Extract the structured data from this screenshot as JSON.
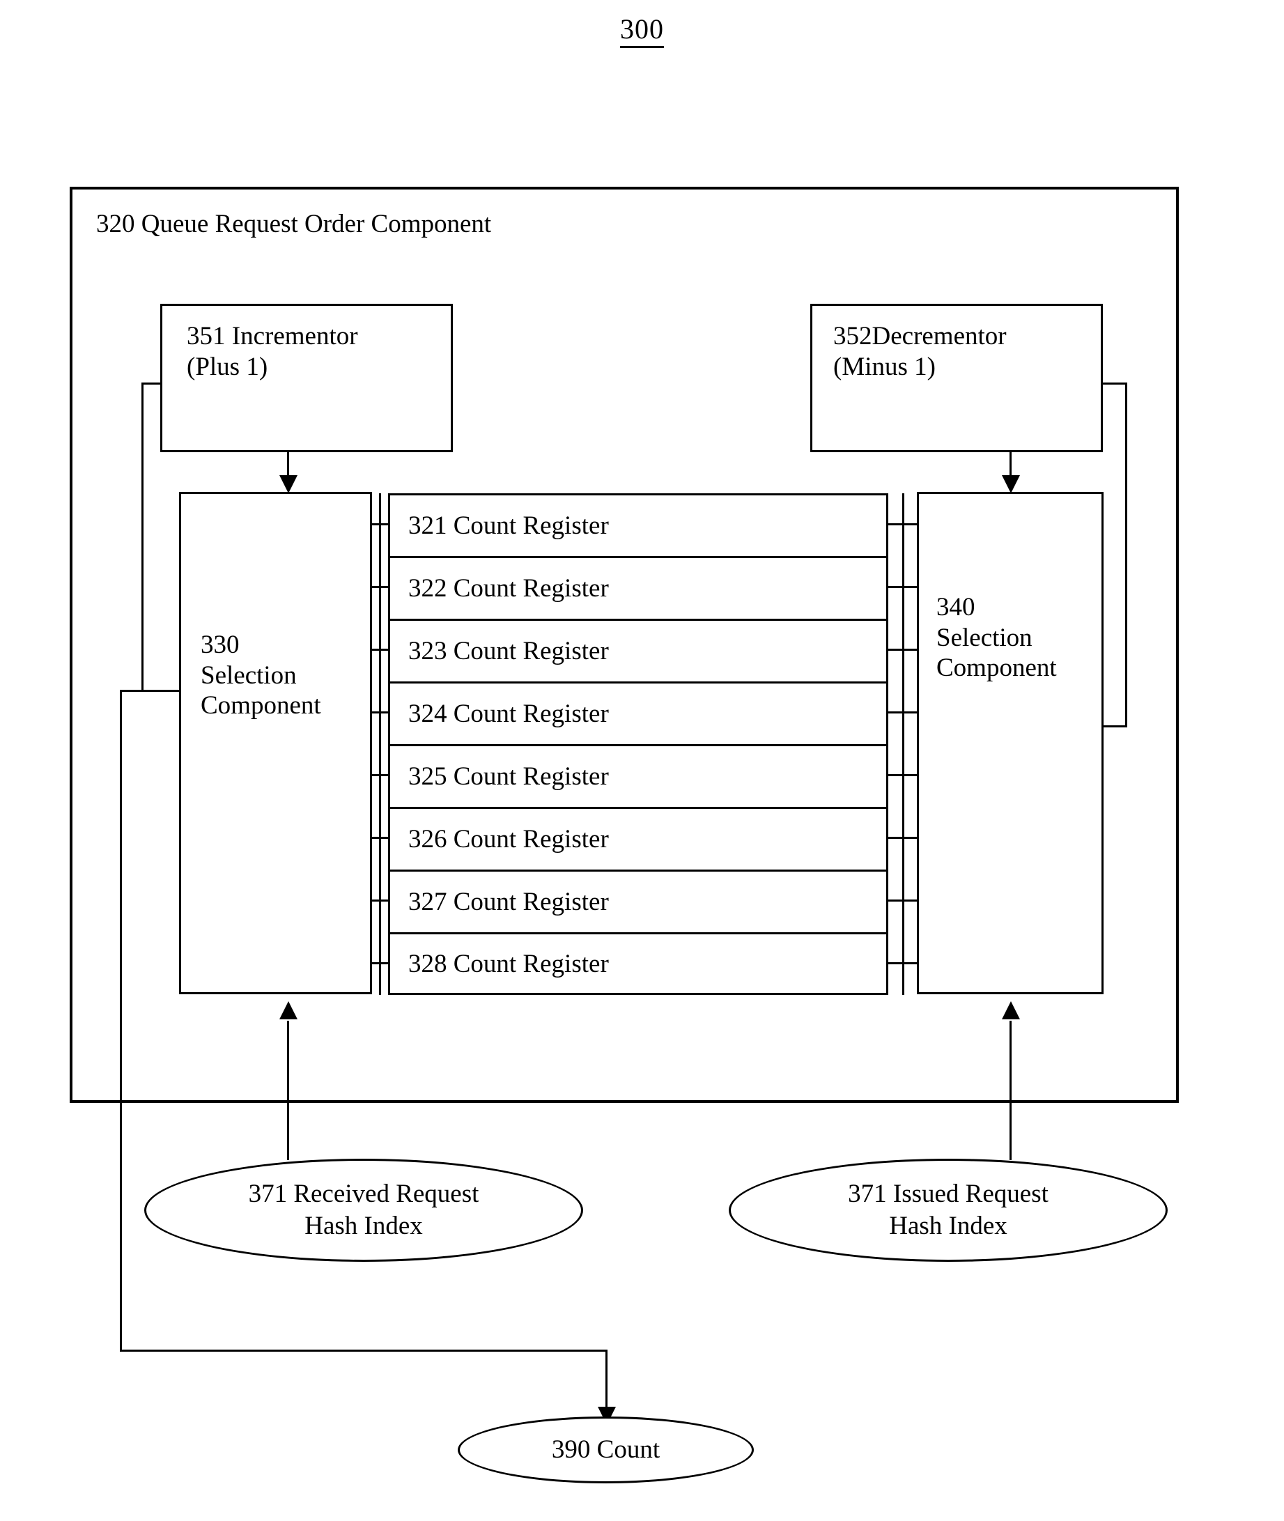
{
  "figure": {
    "number": "300"
  },
  "outer": {
    "label": "320 Queue Request Order Component"
  },
  "incrementor": {
    "label": "351 Incrementor\n(Plus 1)"
  },
  "decrementor": {
    "label": "352Decrementor\n(Minus 1)"
  },
  "selection_left": {
    "label": "330\nSelection\nComponent"
  },
  "selection_right": {
    "label": "340\nSelection\nComponent"
  },
  "registers": [
    {
      "label": "321 Count Register"
    },
    {
      "label": "322 Count Register"
    },
    {
      "label": "323 Count Register"
    },
    {
      "label": "324 Count Register"
    },
    {
      "label": "325 Count Register"
    },
    {
      "label": "326 Count Register"
    },
    {
      "label": "327 Count Register"
    },
    {
      "label": "328 Count Register"
    }
  ],
  "inputs": {
    "received": "371 Received Request\nHash Index",
    "issued": "371 Issued Request\nHash Index"
  },
  "output": {
    "count": "390 Count"
  }
}
